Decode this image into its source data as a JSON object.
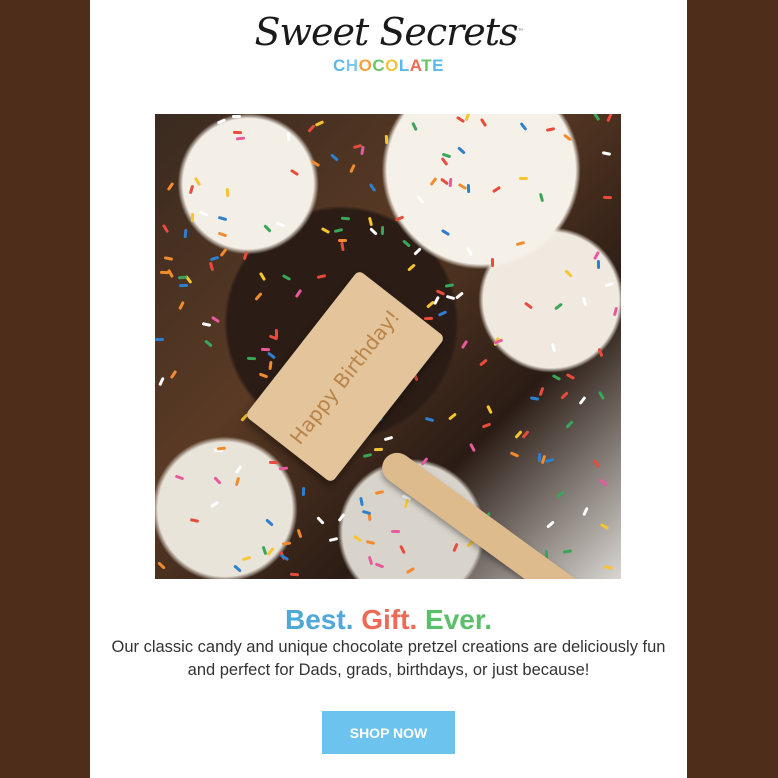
{
  "brand": {
    "logo_script": "Sweet Secrets",
    "logo_tm": "™",
    "logo_sub_letters": [
      {
        "ch": "C",
        "color": "#5bb8e8"
      },
      {
        "ch": "H",
        "color": "#7cc7ef"
      },
      {
        "ch": "O",
        "color": "#f5a03c"
      },
      {
        "ch": "C",
        "color": "#6cc36a"
      },
      {
        "ch": "O",
        "color": "#f2c33a"
      },
      {
        "ch": "L",
        "color": "#5bb8e8"
      },
      {
        "ch": "A",
        "color": "#ef6a55"
      },
      {
        "ch": "T",
        "color": "#6cc36a"
      },
      {
        "ch": "E",
        "color": "#5bb8e8"
      }
    ]
  },
  "hero": {
    "mallet_engraving": "Happy Birthday!"
  },
  "headline": {
    "parts": [
      {
        "text": "Best.",
        "color": "#4fa9d8"
      },
      {
        "text": "Gift.",
        "color": "#ee6a55"
      },
      {
        "text": "Ever.",
        "color": "#5bbf6a"
      }
    ]
  },
  "body": "Our classic candy and unique chocolate pretzel creations are deliciously fun and perfect for Dads, grads, birthdays, or just because!",
  "cta": {
    "label": "SHOP NOW",
    "color": "#6cc4ee"
  },
  "colors": {
    "background": "#4e2e1a",
    "panel": "#ffffff"
  }
}
